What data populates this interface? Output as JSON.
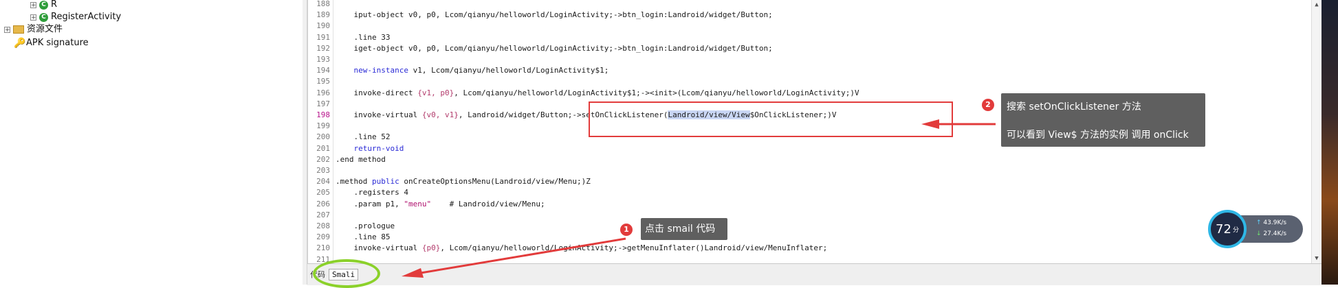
{
  "tree": [
    {
      "label": "R",
      "icon": "class-icon"
    },
    {
      "label": "RegisterActivity",
      "icon": "class-icon"
    },
    {
      "label": "资源文件",
      "icon": "folder-icon"
    },
    {
      "label": "APK signature",
      "icon": "key-icon"
    }
  ],
  "code_lines": [
    {
      "n": "188",
      "text": ""
    },
    {
      "n": "189",
      "text": "    iput-object v0, p0, Lcom/qianyu/helloworld/LoginActivity;->btn_login:Landroid/widget/Button;"
    },
    {
      "n": "190",
      "text": ""
    },
    {
      "n": "191",
      "text": "    .line 33"
    },
    {
      "n": "192",
      "text": "    iget-object v0, p0, Lcom/qianyu/helloworld/LoginActivity;->btn_login:Landroid/widget/Button;"
    },
    {
      "n": "193",
      "text": ""
    },
    {
      "n": "194",
      "text": "    new-instance v1, Lcom/qianyu/helloworld/LoginActivity$1;"
    },
    {
      "n": "195",
      "text": ""
    },
    {
      "n": "196",
      "text": "    invoke-direct {v1, p0}, Lcom/qianyu/helloworld/LoginActivity$1;-><init>(Lcom/qianyu/helloworld/LoginActivity;)V"
    },
    {
      "n": "197",
      "text": ""
    },
    {
      "n": "198",
      "text": "    invoke-virtual {v0, v1}, Landroid/widget/Button;->setOnClickListener(Landroid/view/View$OnClickListener;)V"
    },
    {
      "n": "199",
      "text": ""
    },
    {
      "n": "200",
      "text": "    .line 52"
    },
    {
      "n": "201",
      "text": "    return-void"
    },
    {
      "n": "202",
      "text": ".end method"
    },
    {
      "n": "203",
      "text": ""
    },
    {
      "n": "204",
      "text": ".method public onCreateOptionsMenu(Landroid/view/Menu;)Z"
    },
    {
      "n": "205",
      "text": "    .registers 4"
    },
    {
      "n": "206",
      "text": "    .param p1, \"menu\"    # Landroid/view/Menu;"
    },
    {
      "n": "207",
      "text": ""
    },
    {
      "n": "208",
      "text": "    .prologue"
    },
    {
      "n": "209",
      "text": "    .line 85"
    },
    {
      "n": "210",
      "text": "    invoke-virtual {p0}, Lcom/qianyu/helloworld/LoginActivity;->getMenuInflater()Landroid/view/MenuInflater;"
    },
    {
      "n": "211",
      "text": ""
    }
  ],
  "line198": {
    "prefix": "    invoke-virtual ",
    "args": "{v0, v1}",
    "mid": ", Landroid/widget/Button;->setOnClickListener(",
    "highlight": "Landroid/view/View",
    "after": "$OnClickListener;",
    "tail": ")V"
  },
  "bottom_tabs": {
    "prev": "代码",
    "smali": "Smali"
  },
  "callout_1": {
    "badge": "1",
    "text": "点击 smail 代码"
  },
  "callout_2": {
    "badge": "2",
    "title": "搜索 setOnClickListener 方法",
    "body": "可以看到 View$ 方法的实例 调用 onClick"
  },
  "speed_widget": {
    "score": "72",
    "unit": "分",
    "up": "43.9K/s",
    "down": "27.4K/s"
  },
  "colors": {
    "accent_red": "#e23b3b",
    "green_ring": "#8bd12a",
    "highlight": "#c9d6f4"
  }
}
